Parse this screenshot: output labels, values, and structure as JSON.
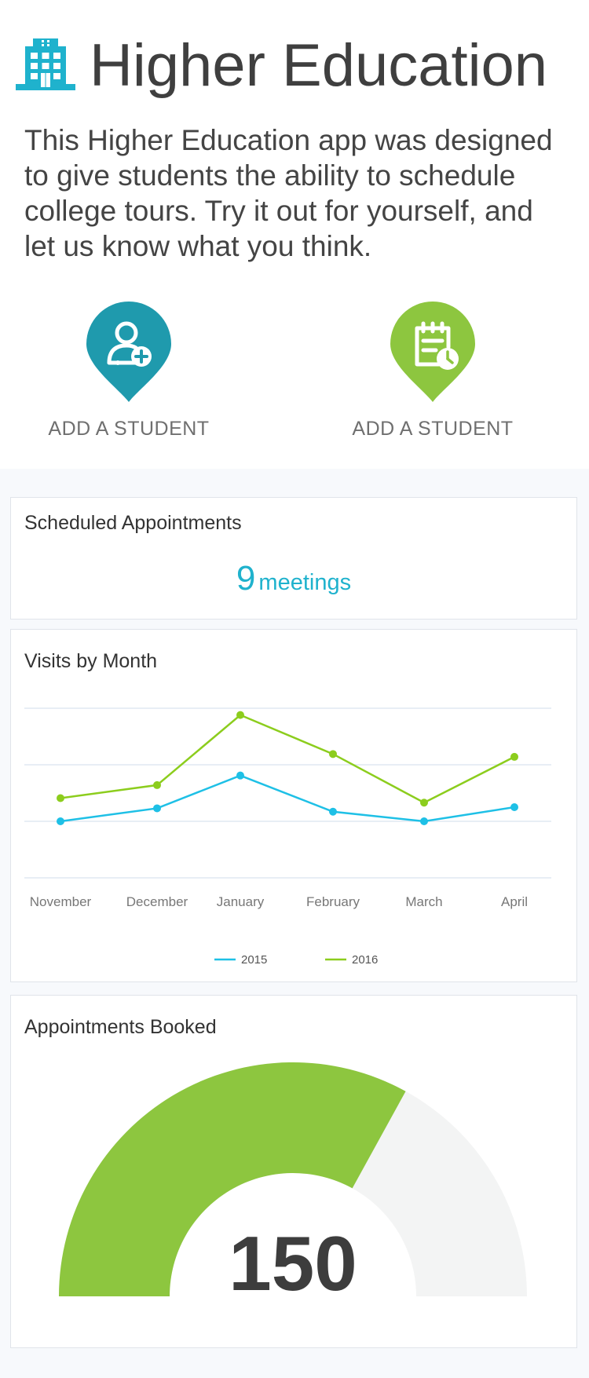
{
  "app": {
    "title": "Higher Education",
    "icon": "building-icon",
    "description": "This Higher Education app was designed to give students the ability to schedule college tours. Try it out for yourself, and let us know what you think."
  },
  "actions": [
    {
      "label": "ADD A STUDENT",
      "icon": "add-user-icon",
      "color": "#1f9aad"
    },
    {
      "label": "ADD A STUDENT",
      "icon": "calendar-clock-icon",
      "color": "#8dc63f"
    }
  ],
  "colors": {
    "accent_teal": "#1fb2cd",
    "accent_green": "#8dc63f",
    "gauge_track": "#f3f4f4"
  },
  "scheduled": {
    "title": "Scheduled Appointments",
    "count": "9",
    "unit": "meetings"
  },
  "visits": {
    "title": "Visits by Month"
  },
  "booked": {
    "title": "Appointments Booked",
    "value": "150"
  },
  "chart_data": [
    {
      "type": "line",
      "title": "Visits by Month",
      "categories": [
        "November",
        "December",
        "January",
        "February",
        "March",
        "April"
      ],
      "series": [
        {
          "name": "2015",
          "color": "#1ec0e6",
          "values": [
            1.0,
            1.23,
            1.81,
            1.17,
            1.0,
            1.25
          ]
        },
        {
          "name": "2016",
          "color": "#8ccd1d",
          "values": [
            1.41,
            1.64,
            2.88,
            2.19,
            1.33,
            2.14
          ]
        }
      ],
      "ylim": [
        0,
        3
      ],
      "grid": true,
      "legend": "bottom"
    },
    {
      "type": "gauge",
      "title": "Appointments Booked",
      "value": 150,
      "fill_fraction": 0.66,
      "color": "#8dc63f"
    }
  ]
}
